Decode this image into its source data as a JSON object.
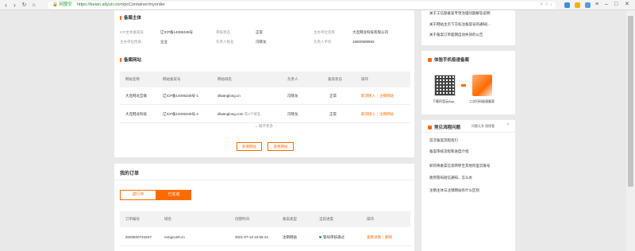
{
  "browser": {
    "secure_label": "🔒 网盟安",
    "url_host": "https://beian.aliyun.com",
    "url_path": "/pcContainer/myorder"
  },
  "record_subject": {
    "title": "备案主体",
    "fields": [
      {
        "label": "ICP主体备案号",
        "value": "辽ICP备14006349号"
      },
      {
        "label": "审核状态",
        "value": "正常"
      },
      {
        "label": "主办单位名称",
        "value": "大连网龙科技有限公司"
      },
      {
        "label": "主办单位性质",
        "value": "企业"
      },
      {
        "label": "负责人姓名",
        "value": "冯晓龙"
      },
      {
        "label": "负责人手机",
        "value": "15800589593"
      }
    ]
  },
  "record_sites": {
    "title": "备案网站",
    "columns": [
      "网站名称",
      "网站备案号",
      "网站域名",
      "负责人",
      "备案状态",
      "操作"
    ],
    "rows": [
      {
        "name": "大连网龙互联",
        "icp": "辽ICP备14006349号-1",
        "domain": "dlwanglong.cn",
        "domain_extra": "",
        "person": "冯晓龙",
        "status": "正常",
        "op1": "取消接入",
        "op2": "注销网站"
      },
      {
        "name": "大连网龙科技",
        "icp": "辽ICP备14006349号-2",
        "domain": "dlwanglong.com",
        "domain_extra": "等3个域名",
        "person": "冯晓龙",
        "status": "正常",
        "op1": "取消接入",
        "op2": "注销网站"
      }
    ],
    "collapse_label": "⌄ 展开更多",
    "add_site_button": "新增网站",
    "change_record_button": "变更网站"
  },
  "orders": {
    "title": "我的订单",
    "tabs": [
      {
        "label": "进行中",
        "active": false
      },
      {
        "label": "已完成",
        "active": true
      }
    ],
    "columns": [
      "订单编号",
      "域名",
      "创建时间",
      "备案类型",
      "当前进度",
      "操作"
    ],
    "rows": [
      {
        "id": "20208207342S7",
        "domain": "nongcun5.cn",
        "time": "2021-07-13 10:55:14",
        "type": "注销网站",
        "progress": "管局审核通过",
        "op1": "查看详情",
        "op2": "删除"
      }
    ]
  },
  "sidebar": {
    "announcements": [
      "关于工信部备案专项治理问题解答说明",
      "关于网站主页下方标注备案号的通知(…",
      "关于备案订单超期自动失效的公告"
    ],
    "mobile_card": {
      "title": "体验手机极速备案",
      "qr_caption": "下载阿里云App",
      "phone_caption": "二次扫码极速备案"
    },
    "faq": {
      "title": "常见流程问题",
      "subtitle": "问题太多 搜搜看",
      "more": "›",
      "items": [
        "首次备案流程指引",
        "备案审核流程和进度介绍",
        "如何将备案信息转移至其他阿里云账号",
        "收到管局短信通知，怎么办",
        "注销主体与注销网站有什么区别"
      ]
    }
  },
  "colors": {
    "accent": "#ff6a00",
    "success": "#2aa74a"
  }
}
